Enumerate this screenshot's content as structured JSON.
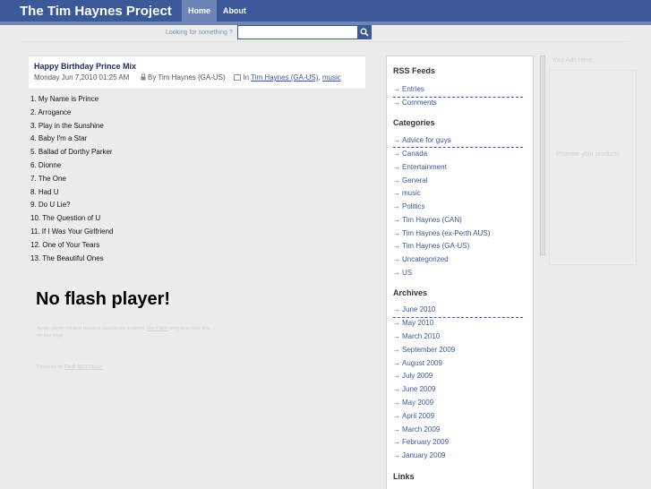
{
  "header": {
    "site_title": "The Tim Haynes Project",
    "nav": [
      {
        "label": "Home",
        "active": true
      },
      {
        "label": "About",
        "active": false
      }
    ]
  },
  "search": {
    "label": "Looking for something ?",
    "value": ""
  },
  "post": {
    "title": "Happy Birthday Prince Mix",
    "date": "Monday Jun 7,2010 01:25 AM",
    "author": "By Tim Haynes (GA-US)",
    "in_label": "In",
    "category": "Tim Haynes (GA-US)",
    "category_sep": ",",
    "tag": "music",
    "tracks": [
      "1. My Name is Prince",
      "2. Arrogance",
      "3. Play in the Sunshine",
      "4. Baby I'm a Star",
      "5. Ballad of Dorthy Parker",
      "6. Dionne",
      "7. The One",
      "8. Had U",
      "9. Do U Lie?",
      "10. The Question of U",
      "11. If I Was Your Girlfriend",
      "12. One of Your Tears",
      "13. The Beautiful Ones"
    ],
    "no_flash": "No flash player!",
    "flash_note_line1": "Audio player content requires JavaScript enabled,",
    "flash_note_link": "Get Flash",
    "flash_note_line1_end": "plug-in to hear this",
    "flash_note_line2": "on this page",
    "powered_prefix": "Powered by",
    "powered_link": "Flash MP3 Player"
  },
  "sidebar": {
    "rss_title": "RSS Feeds",
    "rss": [
      "Entries",
      "Comments"
    ],
    "categories_title": "Categories",
    "categories": [
      "Advice for guys",
      "Canada",
      "Entertainment",
      "General",
      "music",
      "Politics",
      "Tim Haynes (CAN)",
      "Tim Haynes (ex-Perth AUS)",
      "Tim Haynes (GA-US)",
      "Uncategorized",
      "US"
    ],
    "archives_title": "Archives",
    "archives": [
      "June 2010",
      "May 2010",
      "March 2010",
      "September 2009",
      "August 2009",
      "July 2009",
      "June 2009",
      "May 2009",
      "April 2009",
      "March 2009",
      "February 2009",
      "January 2009"
    ],
    "links_title": "Links"
  },
  "ads": {
    "title": "Your Ads Here",
    "body": "Promote your products"
  },
  "colors": {
    "brand": "#3b5998",
    "nav_active": "#6d84b4",
    "background": "#ececec"
  }
}
